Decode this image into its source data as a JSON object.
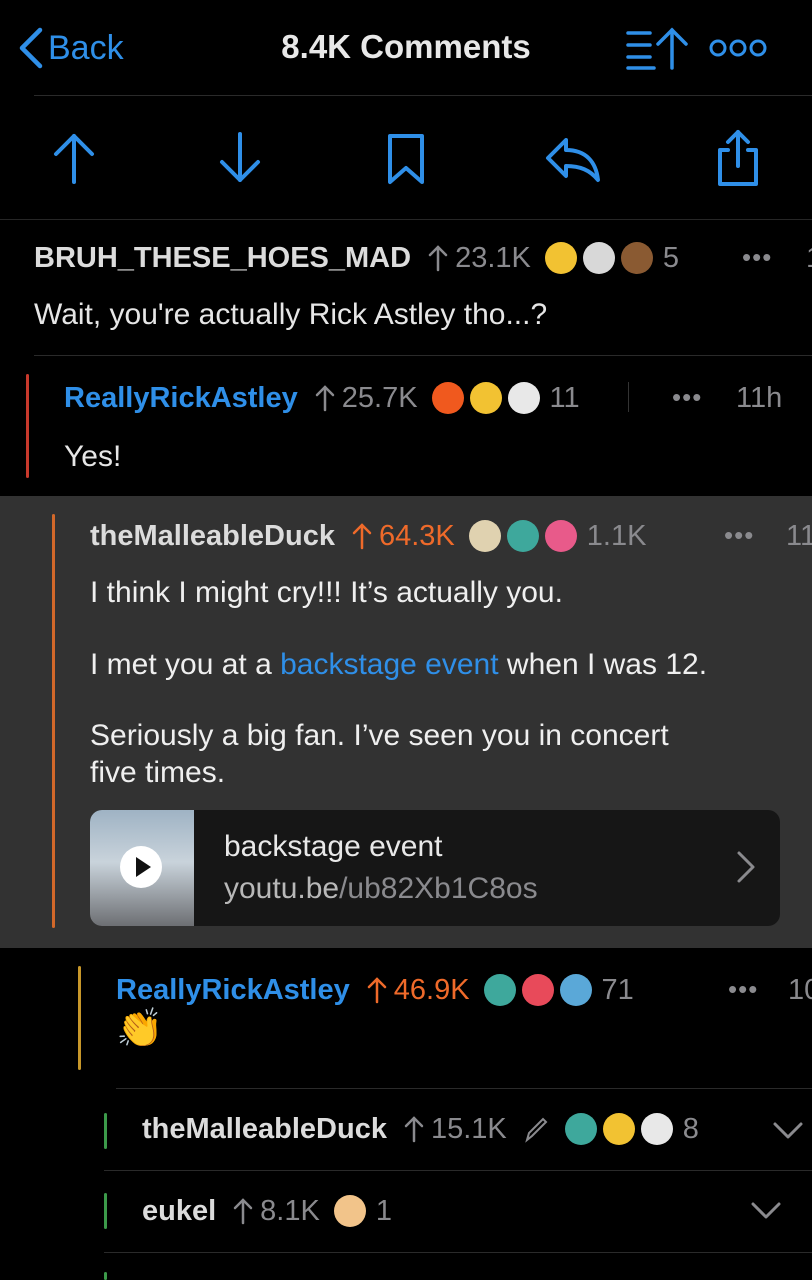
{
  "nav": {
    "back_label": "Back",
    "title": "8.4K Comments"
  },
  "actions": [
    "upvote-icon",
    "downvote-icon",
    "bookmark-icon",
    "reply-icon",
    "share-icon"
  ],
  "colors": {
    "accent": "#2f8fe8",
    "upvoted": "#ef6a2a",
    "highlight_bg": "#323232"
  },
  "comments": [
    {
      "author": "BRUH_THESE_HOES_MAD",
      "score": "23.1K",
      "award_count": "5",
      "time": "1",
      "body": "Wait, you're actually Rick Astley tho...?"
    },
    {
      "author": "ReallyRickAstley",
      "score": "25.7K",
      "award_count": "11",
      "time": "11h",
      "body": "Yes!"
    },
    {
      "author": "theMalleableDuck",
      "score": "64.3K",
      "award_count": "1.1K",
      "time": "11",
      "p1": "I think I might cry!!! It’s actually you.",
      "p2_pre": "I met you at a ",
      "p2_link": "backstage event",
      "p2_post": " when I was 12.",
      "p3_line1": "Seriously a big fan. I’ve seen you in concert",
      "p3_line2": "five times.",
      "link_card": {
        "title": "backstage event",
        "domain": "youtu.be",
        "path": "/ub82Xb1C8os"
      }
    },
    {
      "author": "ReallyRickAstley",
      "score": "46.9K",
      "award_count": "71",
      "time": "10",
      "body": "👏"
    },
    {
      "author": "theMalleableDuck",
      "score": "15.1K",
      "award_count": "8"
    },
    {
      "author": "eukel",
      "score": "8.1K",
      "award_count": "1"
    }
  ]
}
